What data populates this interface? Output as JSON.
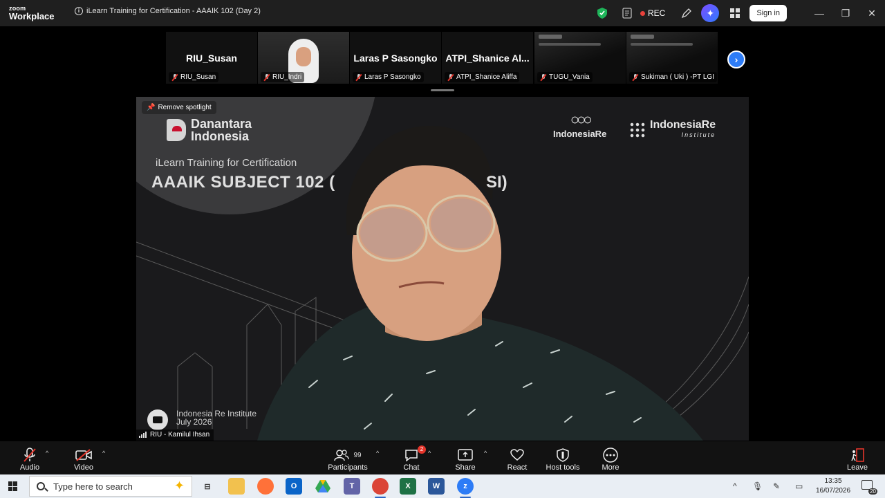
{
  "app": {
    "brand_top": "zoom",
    "brand_bottom": "Workplace",
    "window_title": "iLearn Training for Certification - AAAIK 102 (Day 2)",
    "rec_label": "REC",
    "sign_in_label": "Sign in"
  },
  "thumbnails": [
    {
      "big_name": "RIU_Susan",
      "label": "RIU_Susan",
      "kind": "name"
    },
    {
      "big_name": "",
      "label": "RIU_Indri",
      "kind": "photo"
    },
    {
      "big_name": "Laras P Sasongko",
      "label": "Laras P Sasongko",
      "kind": "name"
    },
    {
      "big_name": "ATPI_Shanice  Al...",
      "label": "ATPI_Shanice Aliffa",
      "kind": "name"
    },
    {
      "big_name": "",
      "label": "TUGU_Vania",
      "kind": "slide"
    },
    {
      "big_name": "",
      "label": "Sukiman ( Uki ) -PT LGI",
      "kind": "slide"
    }
  ],
  "spotlight": {
    "remove_label": "Remove spotlight",
    "speaker_label": "RIU - Kamilul Ihsan",
    "slide": {
      "org_line1": "Danantara",
      "org_line2": "Indonesia",
      "subtitle": "iLearn Training for Certification",
      "heading": "AAAIK SUBJECT 102 (",
      "heading_end": "SI)",
      "logo_left": "IndonesiaRe",
      "logo_right": "IndonesiaRe",
      "logo_right_sub": "Institute",
      "footer_line1": "Indonesia Re Institute",
      "footer_line2": "July 2026"
    }
  },
  "controls": {
    "audio": "Audio",
    "video": "Video",
    "participants": "Participants",
    "participants_count": "99",
    "chat": "Chat",
    "chat_badge": "2",
    "share": "Share",
    "react": "React",
    "host_tools": "Host tools",
    "more": "More",
    "leave": "Leave"
  },
  "taskbar": {
    "search_placeholder": "Type here to search",
    "time": "13:35",
    "date": "16/07/2026",
    "notification_count": "20"
  },
  "colors": {
    "accent_blue": "#2d7cf6",
    "rec_red": "#e8413b",
    "muted_red": "#e5352b"
  }
}
